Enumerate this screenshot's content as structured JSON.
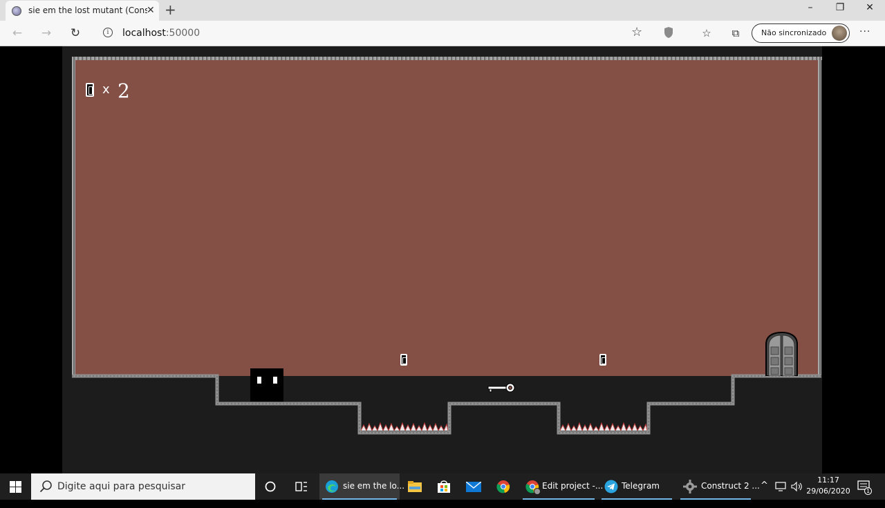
{
  "browser": {
    "tab": {
      "title": "sie em the lost mutant (Construc",
      "favicon": "game-favicon"
    },
    "window_controls": {
      "minimize": "–",
      "restore": "❐",
      "close": "✕"
    },
    "address": {
      "host": "localhost",
      "port": ":50000"
    },
    "sync": {
      "label": "Não sincronizado"
    },
    "icons": [
      "back-icon",
      "forward-icon",
      "refresh-icon",
      "info-icon",
      "star-icon",
      "shield-icon",
      "favorites-icon",
      "collections-icon",
      "more-icon"
    ]
  },
  "game": {
    "hud": {
      "multiplier": "x",
      "coin_count": "2"
    },
    "colors": {
      "background": "#844f45",
      "ground": "#1c1c1c",
      "stone": "#8a8a8a",
      "spikes": "#c23b3b"
    },
    "sprites": [
      "hud-coin",
      "player",
      "coin",
      "coin",
      "key",
      "door",
      "spikes",
      "spikes"
    ]
  },
  "taskbar": {
    "search_placeholder": "Digite aqui para pesquisar",
    "apps": [
      {
        "label": "sie em the lo...",
        "icon": "edge-icon",
        "active": true
      },
      {
        "label": "Edit project -...",
        "icon": "chrome-icon",
        "active": false
      },
      {
        "label": "Telegram",
        "icon": "telegram-icon",
        "active": false
      },
      {
        "label": "Construct 2 ...",
        "icon": "construct-icon",
        "active": false
      }
    ],
    "pinned": [
      "cortana-icon",
      "task-view-icon",
      "file-explorer-icon",
      "store-icon",
      "mail-icon",
      "chrome-icon"
    ],
    "clock": {
      "time": "11:17",
      "date": "29/06/2020"
    },
    "notifications": "1"
  }
}
